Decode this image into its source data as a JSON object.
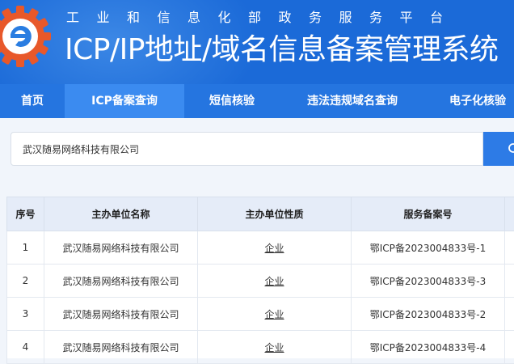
{
  "header": {
    "top_title": "工业和信息化部政务服务平台",
    "main_title": "ICP/IP地址/域名信息备案管理系统"
  },
  "nav": {
    "items": [
      {
        "label": "首页"
      },
      {
        "label": "ICP备案查询"
      },
      {
        "label": "短信核验"
      },
      {
        "label": "违法违规域名查询"
      },
      {
        "label": "电子化核验"
      }
    ],
    "active_index": 1
  },
  "search": {
    "value": "武汉随易网络科技有限公司",
    "icon": "search-icon"
  },
  "table": {
    "headers": [
      "序号",
      "主办单位名称",
      "主办单位性质",
      "服务备案号"
    ],
    "rows": [
      {
        "index": "1",
        "name": "武汉随易网络科技有限公司",
        "type": "企业",
        "record": "鄂ICP备2023004833号-1"
      },
      {
        "index": "2",
        "name": "武汉随易网络科技有限公司",
        "type": "企业",
        "record": "鄂ICP备2023004833号-3"
      },
      {
        "index": "3",
        "name": "武汉随易网络科技有限公司",
        "type": "企业",
        "record": "鄂ICP备2023004833号-2"
      },
      {
        "index": "4",
        "name": "武汉随易网络科技有限公司",
        "type": "企业",
        "record": "鄂ICP备2023004833号-4"
      }
    ]
  },
  "colors": {
    "header_bg": "#1b6ad8",
    "nav_bg": "#2575e0",
    "nav_active": "#3b8bf0",
    "logo_orange": "#e8582a"
  }
}
